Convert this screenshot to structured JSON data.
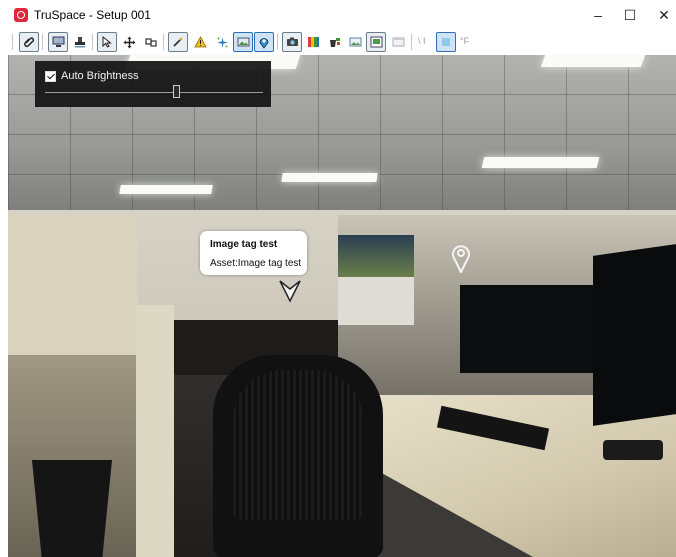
{
  "window": {
    "title": "TruSpace - Setup 001",
    "minimize_glyph": "–",
    "maximize_glyph": "☐",
    "close_glyph": "✕"
  },
  "toolbar": {
    "icons": [
      "clip-icon",
      "monitor-icon",
      "stamp-icon",
      "select-pointer-icon",
      "move-icon",
      "connect-icon",
      "magic-wand-icon",
      "warning-icon",
      "sparkle-icon",
      "image-tag-icon",
      "location-pin-icon",
      "camera-icon",
      "color-palette-icon",
      "bucket-icon",
      "image-icon",
      "screenshot-icon",
      "window-icon",
      "measure-icon",
      "temperature-icon"
    ],
    "measure_label": "\\ I",
    "temperature_label": "°F"
  },
  "brightness": {
    "checked": true,
    "label": "Auto Brightness",
    "level": 0.6
  },
  "tag": {
    "title": "Image tag test",
    "asset": "Asset:Image tag test"
  }
}
